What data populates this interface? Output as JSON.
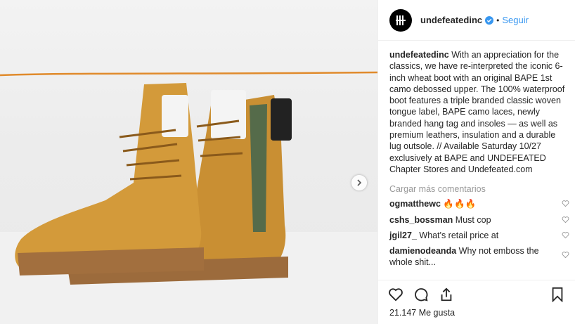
{
  "post": {
    "username": "undefeatedinc",
    "follow_label": "Seguir",
    "dot": "•",
    "caption_user": "undefeatedinc",
    "caption_text": " With an appreciation for the classics, we have re-interpreted the iconic 6-inch wheat boot with an original BAPE 1st camo debossed upper. The 100% waterproof boot features a triple branded classic woven tongue label, BAPE camo laces, newly branded hang tag and insoles — as well as premium leathers, insulation and a durable lug outsole. // Available Saturday 10/27 exclusively at BAPE and UNDEFEATED Chapter Stores and Undefeated.com",
    "load_more": "Cargar más comentarios",
    "likes": "21.147 Me gusta"
  },
  "comments": [
    {
      "user": "ogmatthewc",
      "text": " 🔥🔥🔥"
    },
    {
      "user": "cshs_bossman",
      "text": " Must cop"
    },
    {
      "user": "jgil27_",
      "text": " What's retail price at"
    },
    {
      "user": "damienodeanda",
      "text": " Why not emboss the whole shit..."
    }
  ],
  "colors": {
    "accent": "#3897f0",
    "text": "#262626",
    "muted": "#999999"
  },
  "icons": [
    "heart-icon",
    "comment-icon",
    "share-icon",
    "bookmark-icon",
    "verified-badge-icon",
    "chevron-right-icon"
  ]
}
